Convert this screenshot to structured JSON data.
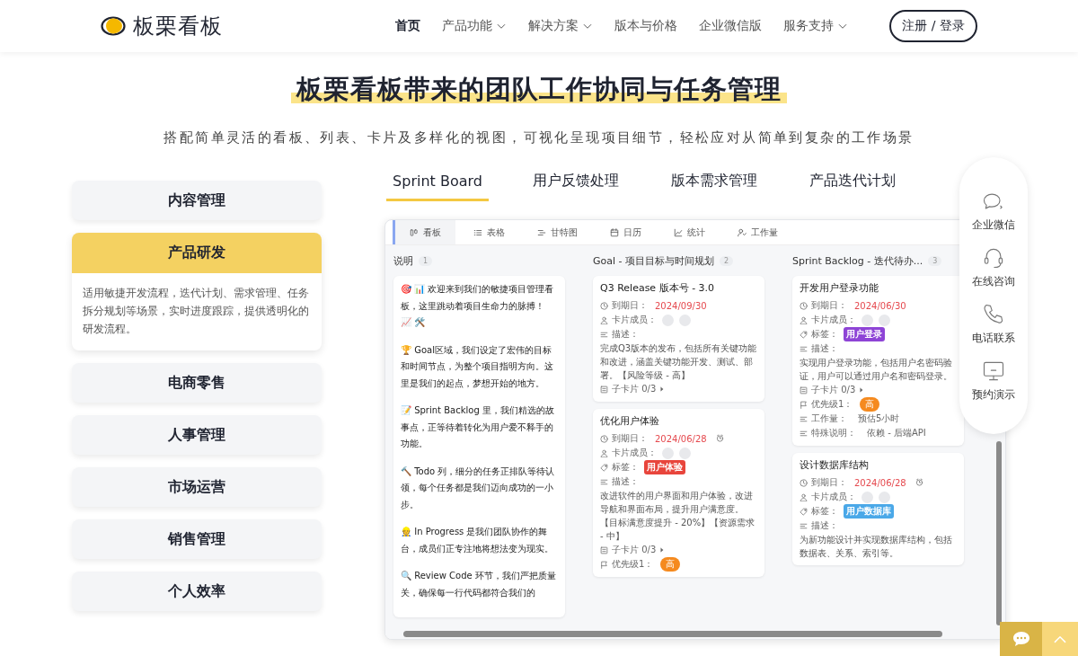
{
  "header": {
    "logo_text": "板栗看板",
    "nav": [
      {
        "label": "首页",
        "selected": true,
        "dropdown": false
      },
      {
        "label": "产品功能",
        "selected": false,
        "dropdown": true
      },
      {
        "label": "解决方案",
        "selected": false,
        "dropdown": true
      },
      {
        "label": "版本与价格",
        "selected": false,
        "dropdown": false
      },
      {
        "label": "企业微信版",
        "selected": false,
        "dropdown": false
      },
      {
        "label": "服务支持",
        "selected": false,
        "dropdown": true
      }
    ],
    "login_button": "注册 / 登录"
  },
  "hero": {
    "title": "板栗看板带来的团队工作协同与任务管理",
    "subtitle": "搭配简单灵活的看板、列表、卡片及多样化的视图，可视化呈现项目细节，轻松应对从简单到复杂的工作场景"
  },
  "scenarios": [
    {
      "label": "内容管理",
      "selected": false
    },
    {
      "label": "产品研发",
      "selected": true,
      "description": "适用敏捷开发流程，迭代计划、需求管理、任务拆分规划等场景，实时进度跟踪，提供透明化的研发流程。"
    },
    {
      "label": "电商零售",
      "selected": false
    },
    {
      "label": "人事管理",
      "selected": false
    },
    {
      "label": "市场运营",
      "selected": false
    },
    {
      "label": "销售管理",
      "selected": false
    },
    {
      "label": "个人效率",
      "selected": false
    }
  ],
  "showcase_tabs": [
    {
      "label": "Sprint Board",
      "selected": true
    },
    {
      "label": "用户反馈处理",
      "selected": false
    },
    {
      "label": "版本需求管理",
      "selected": false
    },
    {
      "label": "产品迭代计划",
      "selected": false
    }
  ],
  "board": {
    "views": [
      {
        "label": "看板",
        "selected": true
      },
      {
        "label": "表格",
        "selected": false
      },
      {
        "label": "甘特图",
        "selected": false
      },
      {
        "label": "日历",
        "selected": false
      },
      {
        "label": "统计",
        "selected": false
      },
      {
        "label": "工作量",
        "selected": false
      }
    ],
    "columns": [
      {
        "title": "说明",
        "count": "1",
        "cards": [
          {
            "kind": "note",
            "paragraphs": [
              "🎯 📊 欢迎来到我们的敏捷项目管理看板，这里跳动着项目生命力的脉搏！ 📈 🛠️",
              "🏆 Goal区域，我们设定了宏伟的目标和时间节点，为整个项目指明方向。这里是我们的起点，梦想开始的地方。",
              "📝 Sprint Backlog 里，我们精选的故事点，正等待着转化为用户爱不释手的功能。",
              "🔨 Todo 列，细分的任务正排队等待认领，每个任务都是我们迈向成功的一小步。",
              "👷 In Progress 是我们团队协作的舞台，成员们正专注地将想法变为现实。",
              "🔍 Review Code 环节，我们严把质量关，确保每一行代码都符合我们的"
            ]
          }
        ]
      },
      {
        "title": "Goal - 项目目标与时间规划",
        "count": "2",
        "cards": [
          {
            "kind": "task",
            "title": "Q3 Release 版本号 - 3.0",
            "rows": [
              {
                "kind": "due",
                "label": "到期日：",
                "value": "2024/09/30",
                "alarm": false
              },
              {
                "kind": "members",
                "label": "卡片成员："
              },
              {
                "kind": "desc",
                "label": "描述：",
                "text": "完成Q3版本的发布，包括所有关键功能和改进，涵盖关键功能开发、测试、部署。【风险等级 - 高】"
              },
              {
                "kind": "subcards",
                "label": "子卡片 0/3"
              }
            ]
          },
          {
            "kind": "task",
            "title": "优化用户体验",
            "rows": [
              {
                "kind": "due",
                "label": "到期日：",
                "value": "2024/06/28",
                "alarm": true
              },
              {
                "kind": "members",
                "label": "卡片成员："
              },
              {
                "kind": "tag",
                "label": "标签：",
                "tag": "用户体验",
                "color": "#e8453c"
              },
              {
                "kind": "desc",
                "label": "描述：",
                "text": "改进软件的用户界面和用户体验，改进导航和界面布局，提升用户满意度。【目标满意度提升 - 20%】【资源需求 - 中】"
              },
              {
                "kind": "subcards",
                "label": "子卡片 0/3"
              },
              {
                "kind": "priority",
                "label": "优先级1：",
                "value": "高"
              }
            ]
          }
        ]
      },
      {
        "title": "Sprint Backlog - 迭代待办...",
        "count": "3",
        "cards": [
          {
            "kind": "task",
            "title": "开发用户登录功能",
            "rows": [
              {
                "kind": "due",
                "label": "到期日：",
                "value": "2024/06/30",
                "alarm": false
              },
              {
                "kind": "members",
                "label": "卡片成员："
              },
              {
                "kind": "tag",
                "label": "标签：",
                "tag": "用户登录",
                "color": "#8e44d6"
              },
              {
                "kind": "desc",
                "label": "描述：",
                "text": "实现用户登录功能，包括用户名密码验证，用户可以通过用户名和密码登录。"
              },
              {
                "kind": "subcards",
                "label": "子卡片 0/3"
              },
              {
                "kind": "priority",
                "label": "优先级1：",
                "value": "高"
              },
              {
                "kind": "field",
                "label": "工作量：",
                "value": "预估5小时"
              },
              {
                "kind": "field",
                "label": "特殊说明：",
                "value": "依赖 - 后端API"
              }
            ]
          },
          {
            "kind": "task",
            "title": "设计数据库结构",
            "rows": [
              {
                "kind": "due",
                "label": "到期日：",
                "value": "2024/06/28",
                "alarm": true
              },
              {
                "kind": "members",
                "label": "卡片成员："
              },
              {
                "kind": "tag",
                "label": "标签：",
                "tag": "用户数据库",
                "color": "#4aa8e8"
              },
              {
                "kind": "desc",
                "label": "描述：",
                "text": "为新功能设计并实现数据库结构，包括数据表、关系、索引等。"
              }
            ]
          }
        ]
      }
    ]
  },
  "contact_panel": [
    {
      "label": "企业微信"
    },
    {
      "label": "在线咨询"
    },
    {
      "label": "电话联系"
    },
    {
      "label": "预约演示"
    }
  ]
}
